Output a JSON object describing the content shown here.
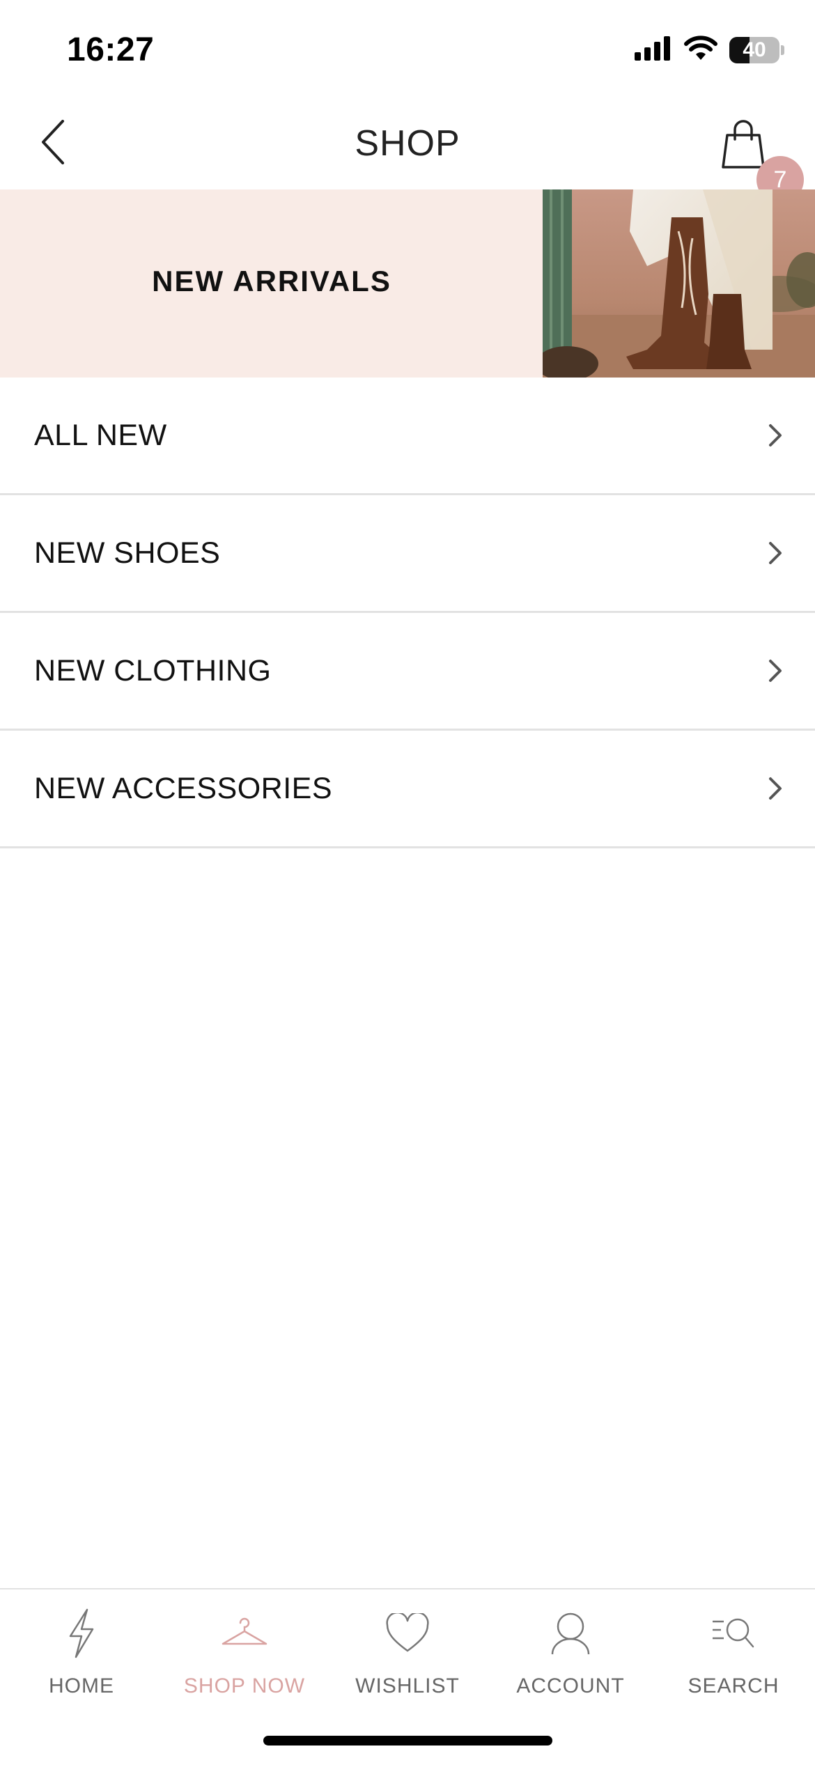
{
  "status_bar": {
    "time": "16:27",
    "battery_level": "40",
    "battery_fraction": 0.4,
    "icons": [
      "cellular-signal-icon",
      "wifi-icon",
      "battery-icon"
    ]
  },
  "header": {
    "title": "SHOP",
    "back_icon": "chevron-left-icon",
    "cart_icon": "shopping-bag-icon",
    "cart_count": "7"
  },
  "banner": {
    "title": "NEW ARRIVALS"
  },
  "categories": [
    {
      "label": "ALL NEW"
    },
    {
      "label": "NEW SHOES"
    },
    {
      "label": "NEW CLOTHING"
    },
    {
      "label": "NEW ACCESSORIES"
    }
  ],
  "tab_bar": {
    "tabs": [
      {
        "label": "HOME",
        "icon": "lightning-bolt-icon",
        "active": false
      },
      {
        "label": "SHOP NOW",
        "icon": "hanger-icon",
        "active": true
      },
      {
        "label": "WISHLIST",
        "icon": "heart-icon",
        "active": false
      },
      {
        "label": "ACCOUNT",
        "icon": "user-icon",
        "active": false
      },
      {
        "label": "SEARCH",
        "icon": "search-icon",
        "active": false
      }
    ]
  },
  "colors": {
    "accent": "#d9a3a1",
    "banner_bg": "#f9ebe6",
    "divider": "#e2e2e2",
    "text": "#111111",
    "inactive_tab": "#666666"
  }
}
